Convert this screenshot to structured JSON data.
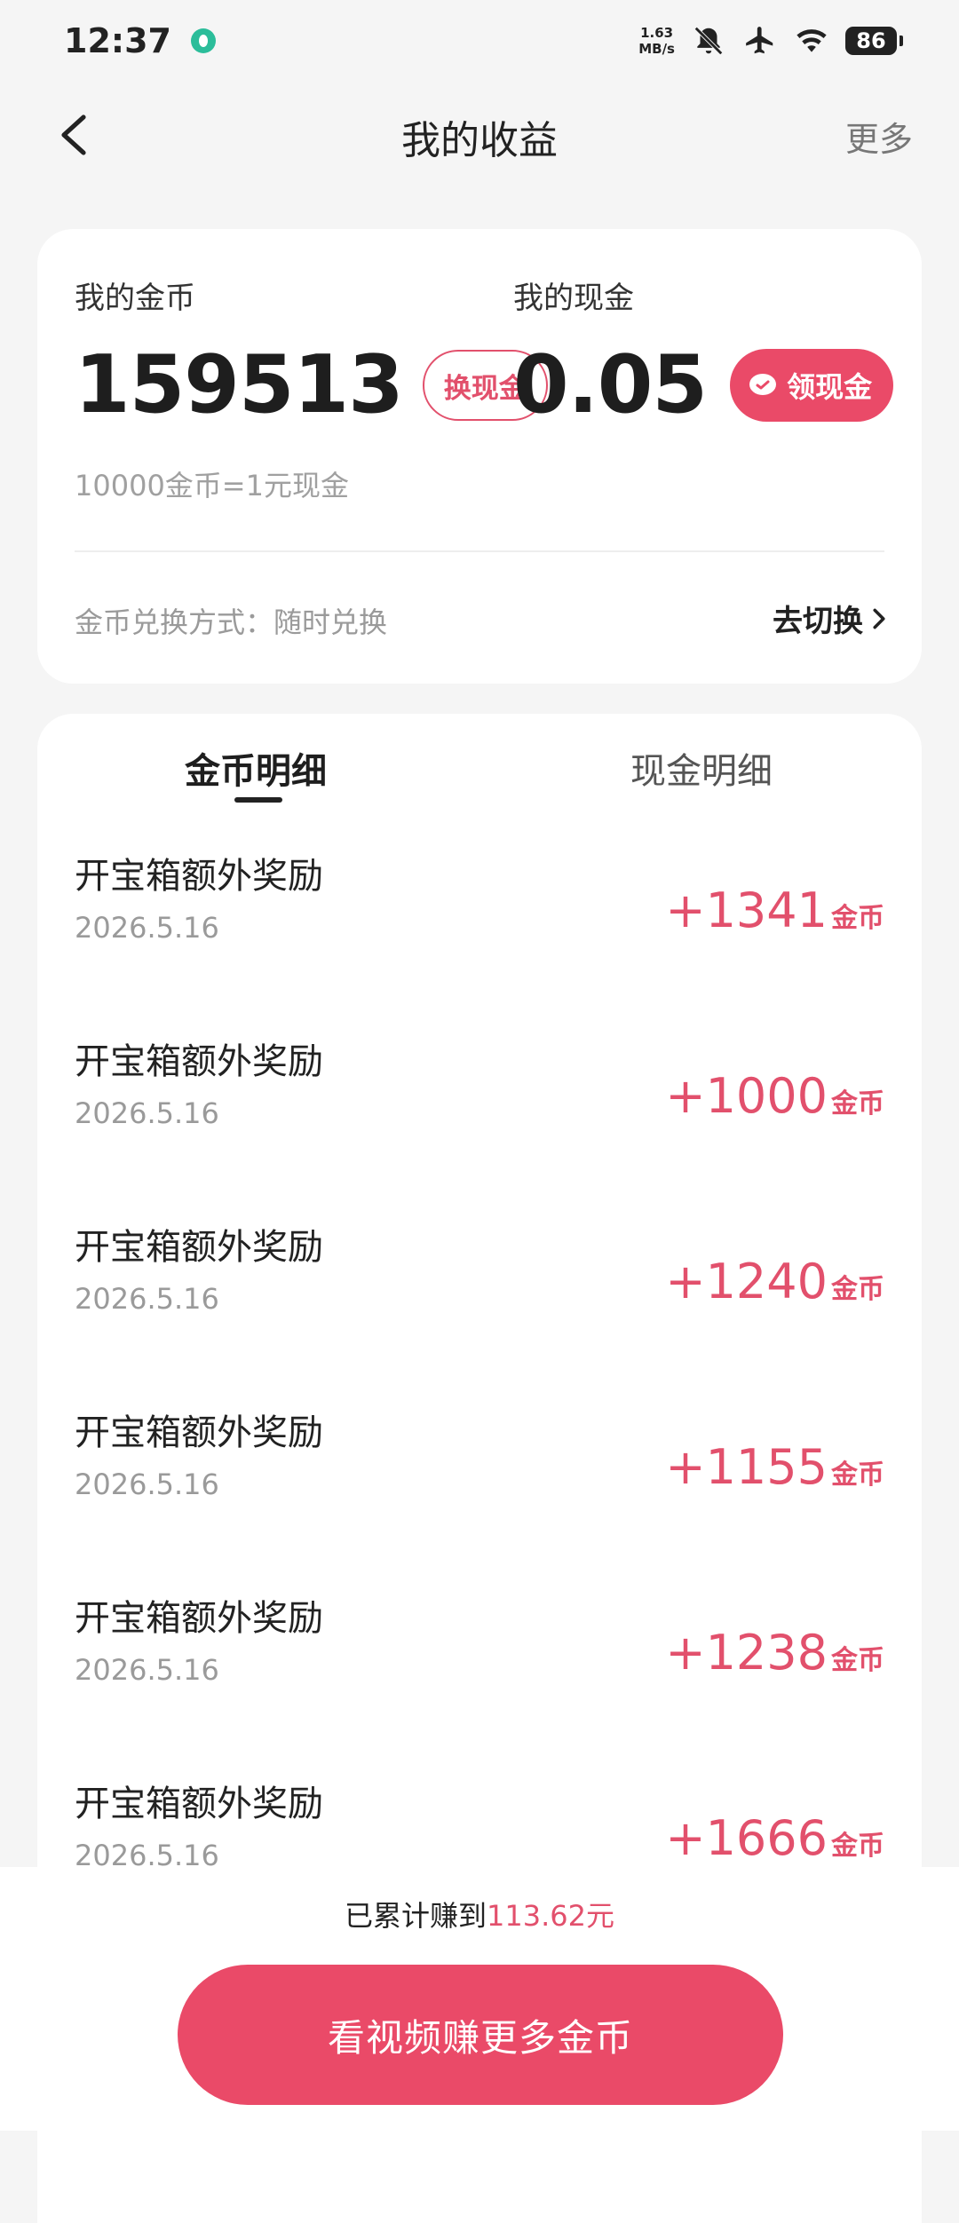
{
  "status_bar": {
    "time": "12:37",
    "net_speed_value": "1.63",
    "net_speed_unit": "MB/s",
    "battery": "86"
  },
  "nav": {
    "title": "我的收益",
    "more": "更多"
  },
  "balance": {
    "coins_label": "我的金币",
    "coins_value": "159513",
    "exchange_button": "换现金",
    "cash_label": "我的现金",
    "cash_value": "0.05",
    "withdraw_button": "领现金",
    "rate": "10000金币=1元现金",
    "exchange_mode": "金币兑换方式：随时兑换",
    "switch_link": "去切换"
  },
  "tabs": {
    "coins": "金币明细",
    "cash": "现金明细"
  },
  "records": [
    {
      "title": "开宝箱额外奖励",
      "date": "2026.5.16",
      "amount": "+1341",
      "unit": "金币"
    },
    {
      "title": "开宝箱额外奖励",
      "date": "2026.5.16",
      "amount": "+1000",
      "unit": "金币"
    },
    {
      "title": "开宝箱额外奖励",
      "date": "2026.5.16",
      "amount": "+1240",
      "unit": "金币"
    },
    {
      "title": "开宝箱额外奖励",
      "date": "2026.5.16",
      "amount": "+1155",
      "unit": "金币"
    },
    {
      "title": "开宝箱额外奖励",
      "date": "2026.5.16",
      "amount": "+1238",
      "unit": "金币"
    },
    {
      "title": "开宝箱额外奖励",
      "date": "2026.5.16",
      "amount": "+1666",
      "unit": "金币"
    }
  ],
  "footer": {
    "earned_prefix": "已累计赚到",
    "earned_amount": "113.62元",
    "cta": "看视频赚更多金币"
  },
  "colors": {
    "accent": "#e2506c",
    "button": "#ea4a68",
    "background": "#f5f5f5"
  }
}
